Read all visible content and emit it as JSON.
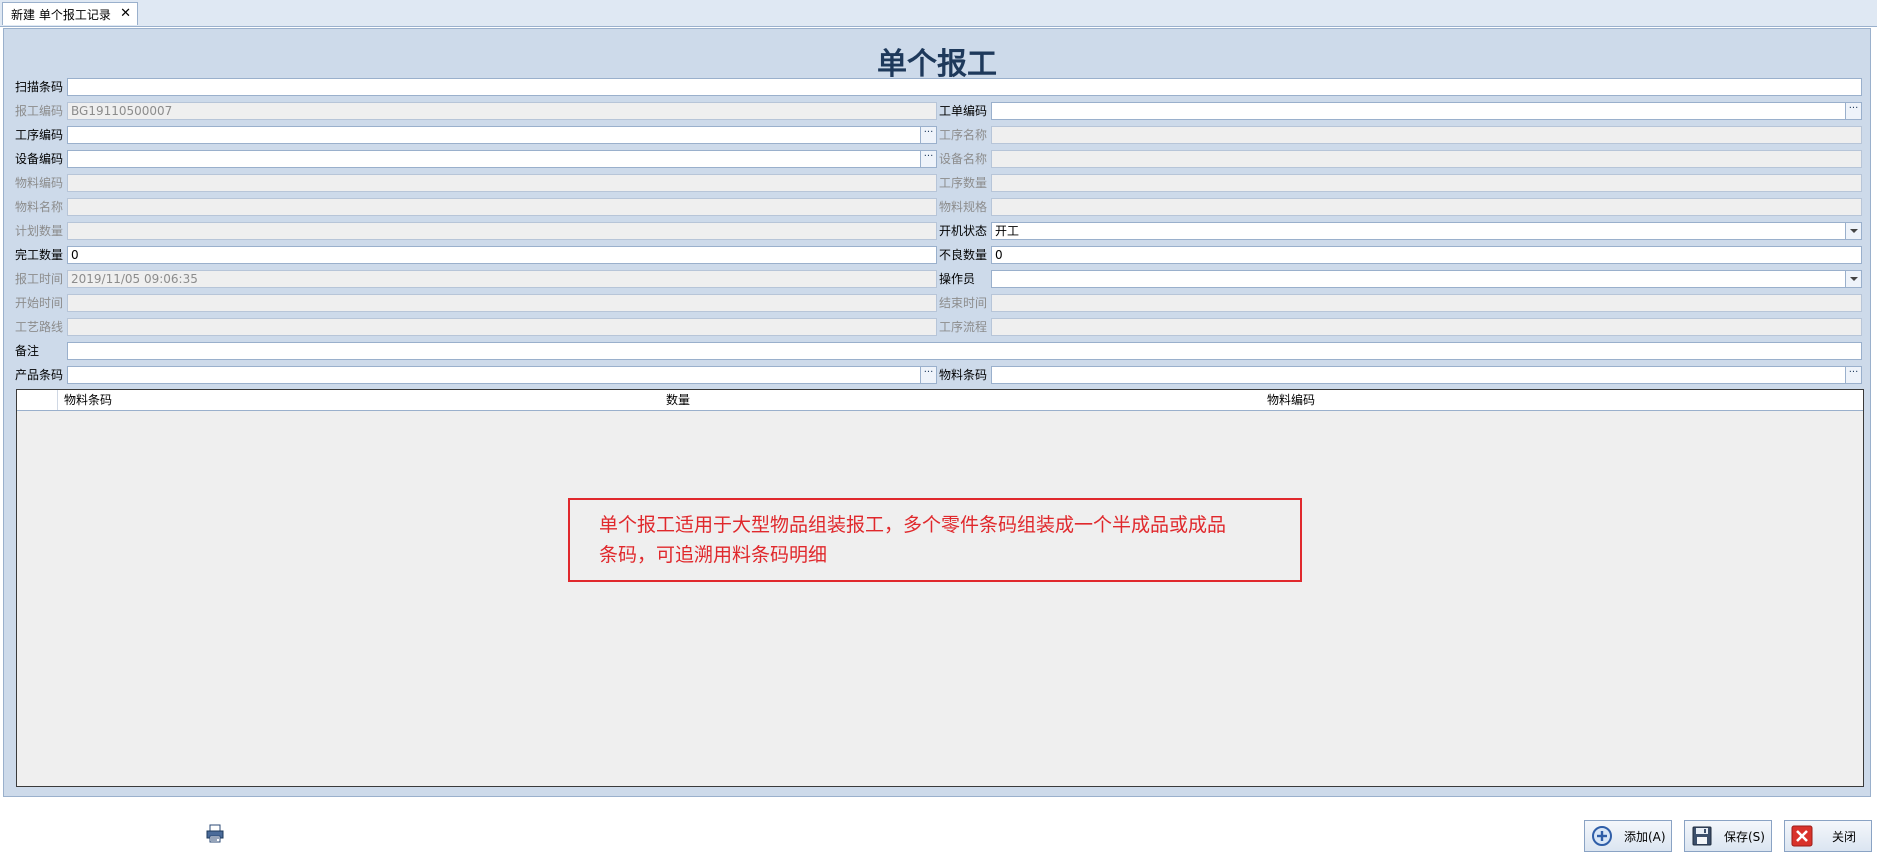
{
  "tab": {
    "label": "新建 单个报工记录",
    "close": "✕"
  },
  "form": {
    "title": "单个报工",
    "scan_barcode": {
      "label": "扫描条码",
      "value": ""
    },
    "report_code": {
      "label": "报工编码",
      "value": "BG19110500007"
    },
    "work_order_code": {
      "label": "工单编码",
      "value": ""
    },
    "process_code": {
      "label": "工序编码",
      "value": ""
    },
    "process_name": {
      "label": "工序名称",
      "value": ""
    },
    "equipment_code": {
      "label": "设备编码",
      "value": ""
    },
    "equipment_name": {
      "label": "设备名称",
      "value": ""
    },
    "material_code": {
      "label": "物料编码",
      "value": ""
    },
    "process_qty": {
      "label": "工序数量",
      "value": ""
    },
    "material_name": {
      "label": "物料名称",
      "value": ""
    },
    "material_spec": {
      "label": "物料规格",
      "value": ""
    },
    "planned_qty": {
      "label": "计划数量",
      "value": ""
    },
    "machine_status": {
      "label": "开机状态",
      "value": "开工"
    },
    "completed_qty": {
      "label": "完工数量",
      "value": "0"
    },
    "defect_qty": {
      "label": "不良数量",
      "value": "0"
    },
    "report_time": {
      "label": "报工时间",
      "value": "2019/11/05 09:06:35"
    },
    "operator": {
      "label": "操作员",
      "value": ""
    },
    "start_time": {
      "label": "开始时间",
      "value": ""
    },
    "end_time": {
      "label": "结束时间",
      "value": ""
    },
    "routing": {
      "label": "工艺路线",
      "value": ""
    },
    "process_flow": {
      "label": "工序流程",
      "value": ""
    },
    "remark": {
      "label": "备注",
      "value": ""
    },
    "product_barcode": {
      "label": "产品条码",
      "value": ""
    },
    "material_barcode": {
      "label": "物料条码",
      "value": ""
    },
    "ellipsis": "···"
  },
  "grid": {
    "columns": [
      "物料条码",
      "数量",
      "物料编码"
    ],
    "rows": []
  },
  "annotation": {
    "line1": "单个报工适用于大型物品组装报工，多个零件条码组装成一个半成品或成品",
    "line2": "条码，可追溯用料条码明细"
  },
  "buttons": {
    "add": "添加(A)",
    "save": "保存(S)",
    "close": "关闭"
  },
  "colors": {
    "panel_bg": "#cddaea",
    "title": "#1e395b",
    "annotation": "#e0282c"
  },
  "icons": {
    "add": "plus-circle-icon",
    "save": "floppy-disk-icon",
    "close": "close-x-icon",
    "printer": "printer-icon"
  }
}
